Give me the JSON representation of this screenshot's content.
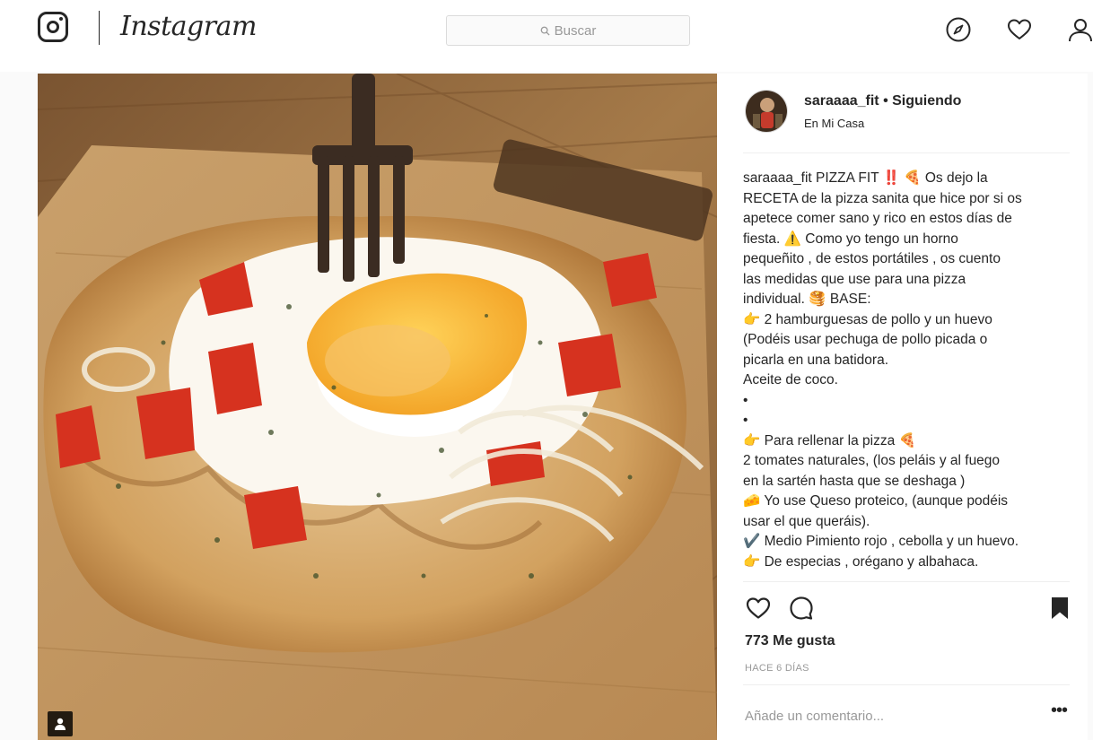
{
  "header": {
    "wordmark": "Instagram",
    "search_placeholder": "Buscar",
    "icons": [
      "camera-logo-icon",
      "compass-icon",
      "heart-icon",
      "user-icon"
    ]
  },
  "post": {
    "author": "saraaaa_fit",
    "follow_status": "Siguiendo",
    "location": "En Mi Casa",
    "caption_lines": [
      "saraaaa_fit PIZZA FIT ‼️ 🍕 Os dejo la",
      "RECETA de la pizza sanita que hice por si os",
      "apetece comer sano y rico en estos días de",
      "fiesta. ⚠️ Como yo tengo un horno",
      "pequeñito , de estos portátiles , os cuento",
      "las medidas que use para una pizza",
      "individual. 🥞 BASE:",
      "👉 2 hamburguesas de pollo y un huevo",
      "(Podéis usar pechuga de pollo picada o",
      "picarla en una batidora.",
      "Aceite de coco.",
      "•",
      "•",
      "👉 Para rellenar la pizza 🍕",
      "2 tomates naturales, (los peláis y al fuego",
      "en la sartén hasta que se deshaga )",
      "🧀 Yo use Queso proteico, (aunque podéis",
      "usar el que queráis).",
      "✔️ Medio Pimiento rojo , cebolla y un huevo.",
      "👉 De especias , orégano y albahaca."
    ],
    "likes": "773 Me gusta",
    "age": "HACE 6 DÍAS",
    "comment_placeholder": "Añade un comentario...",
    "more_label": "•••"
  },
  "colors": {
    "text": "#262626",
    "muted": "#999999",
    "border": "#dbdbdb",
    "background": "#fafafa",
    "alert_red": "#ed4956"
  }
}
